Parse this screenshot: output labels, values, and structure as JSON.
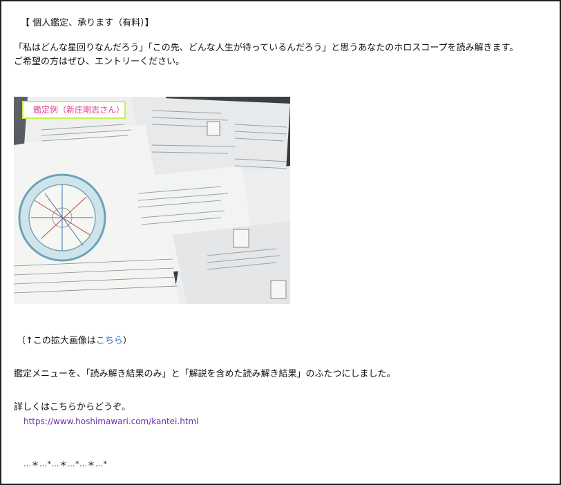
{
  "heading": "【 個人鑑定、承ります（有料）】",
  "intro_line1": "「私はどんな星回りなんだろう」「この先、どんな人生が待っているんだろう」と思うあなたのホロスコープを読み解きます。",
  "intro_line2": "ご希望の方はぜひ、エントリーください。",
  "image": {
    "caption": "鑑定例（新庄剛志さん）"
  },
  "enlarge": {
    "prefix": "（↑この拡大画像は",
    "link_label": "こちら",
    "suffix": "）"
  },
  "menu_text": "鑑定メニューを、「読み解き結果のみ」と「解説を含めた読み解き結果」のふたつにしました。",
  "details_text": "詳しくはこちらからどうぞ。",
  "details_url": "https://www.hoshimawari.com/kantei.html",
  "decoration": "…＊…*…＊…*…＊…*"
}
